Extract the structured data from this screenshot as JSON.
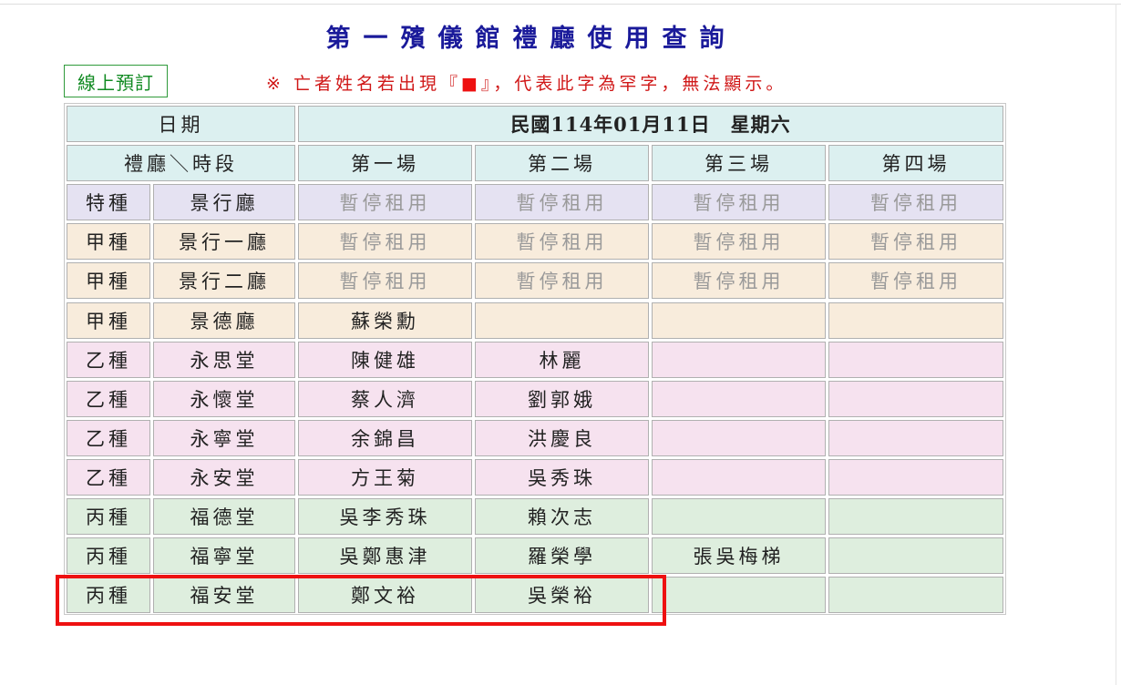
{
  "title": "第一殯儀館禮廳使用查詢",
  "online_booking_label": "線上預訂",
  "notice": "※ 亡者姓名若出現『■』，代表此字為罕字，無法顯示。",
  "notice_mark_color": "#ee1111",
  "table": {
    "date_label": "日期",
    "date_value": "民國114年01月11日　星期六",
    "hall_slot_label": "禮廳＼時段",
    "slots": [
      "第一場",
      "第二場",
      "第三場",
      "第四場"
    ],
    "rows": [
      {
        "category": "特種",
        "hall": "景行廳",
        "slots": [
          "暫停租用",
          "暫停租用",
          "暫停租用",
          "暫停租用"
        ],
        "color": "#e5e2f2",
        "suspended": true
      },
      {
        "category": "甲種",
        "hall": "景行一廳",
        "slots": [
          "暫停租用",
          "暫停租用",
          "暫停租用",
          "暫停租用"
        ],
        "color": "#f8ecdc",
        "suspended": true
      },
      {
        "category": "甲種",
        "hall": "景行二廳",
        "slots": [
          "暫停租用",
          "暫停租用",
          "暫停租用",
          "暫停租用"
        ],
        "color": "#f8ecdc",
        "suspended": true
      },
      {
        "category": "甲種",
        "hall": "景德廳",
        "slots": [
          "蘇榮勳",
          "",
          "",
          ""
        ],
        "color": "#f8ecdc"
      },
      {
        "category": "乙種",
        "hall": "永思堂",
        "slots": [
          "陳健雄",
          "林麗",
          "",
          ""
        ],
        "color": "#f6e2ef"
      },
      {
        "category": "乙種",
        "hall": "永懷堂",
        "slots": [
          "蔡人濟",
          "劉郭娥",
          "",
          ""
        ],
        "color": "#f6e2ef"
      },
      {
        "category": "乙種",
        "hall": "永寧堂",
        "slots": [
          "余錦昌",
          "洪慶良",
          "",
          ""
        ],
        "color": "#f6e2ef"
      },
      {
        "category": "乙種",
        "hall": "永安堂",
        "slots": [
          "方王菊",
          "吳秀珠",
          "",
          ""
        ],
        "color": "#f6e2ef"
      },
      {
        "category": "丙種",
        "hall": "福德堂",
        "slots": [
          "吳李秀珠",
          "賴次志",
          "",
          ""
        ],
        "color": "#deeede"
      },
      {
        "category": "丙種",
        "hall": "福寧堂",
        "slots": [
          "吳鄭惠津",
          "羅榮學",
          "張吳梅梯",
          ""
        ],
        "color": "#deeede"
      },
      {
        "category": "丙種",
        "hall": "福安堂",
        "slots": [
          "鄭文裕",
          "吳榮裕",
          "",
          ""
        ],
        "color": "#deeede"
      }
    ],
    "header_color": "#dcf0f0"
  },
  "highlighted_row": "福安堂",
  "highlight_color": "#ee1111"
}
